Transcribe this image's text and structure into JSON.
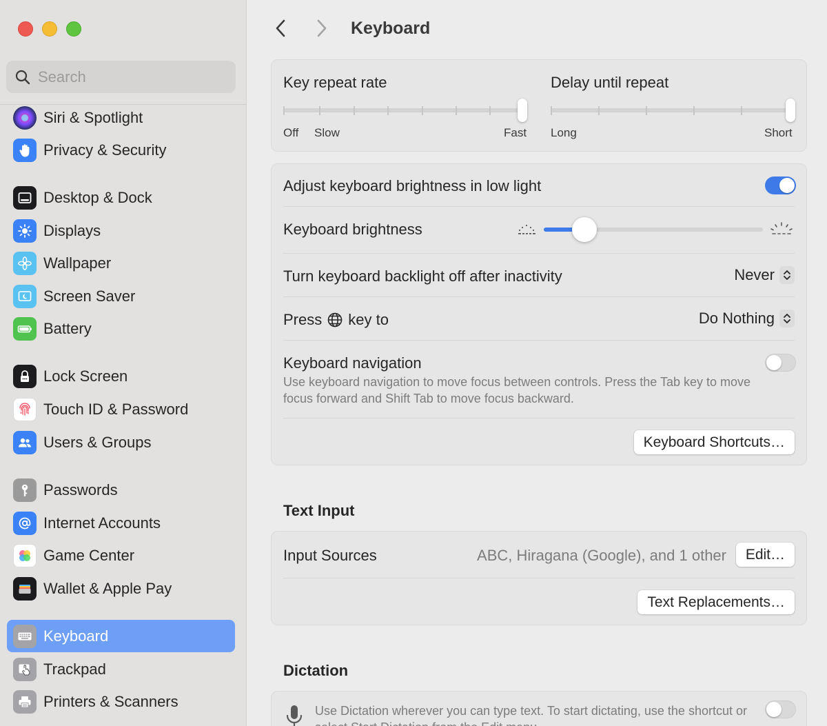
{
  "window": {
    "title": "Keyboard"
  },
  "colors": {
    "accent": "#3f7be8",
    "sidebar_selection": "#6d9ff6"
  },
  "search": {
    "placeholder": "Search"
  },
  "sidebar": {
    "items": [
      {
        "label": "Siri & Spotlight",
        "icon": "siri-icon"
      },
      {
        "label": "Privacy & Security",
        "icon": "hand-icon"
      },
      {
        "label": "Desktop & Dock",
        "icon": "dock-icon"
      },
      {
        "label": "Displays",
        "icon": "sun-icon"
      },
      {
        "label": "Wallpaper",
        "icon": "flower-icon"
      },
      {
        "label": "Screen Saver",
        "icon": "screensaver-icon"
      },
      {
        "label": "Battery",
        "icon": "battery-icon"
      },
      {
        "label": "Lock Screen",
        "icon": "lock-icon"
      },
      {
        "label": "Touch ID & Password",
        "icon": "fingerprint-icon"
      },
      {
        "label": "Users & Groups",
        "icon": "users-icon"
      },
      {
        "label": "Passwords",
        "icon": "key-icon"
      },
      {
        "label": "Internet Accounts",
        "icon": "at-icon"
      },
      {
        "label": "Game Center",
        "icon": "game-center-icon"
      },
      {
        "label": "Wallet & Apple Pay",
        "icon": "wallet-icon"
      },
      {
        "label": "Keyboard",
        "icon": "keyboard-icon",
        "selected": true
      },
      {
        "label": "Trackpad",
        "icon": "trackpad-icon"
      },
      {
        "label": "Printers & Scanners",
        "icon": "printer-icon"
      }
    ]
  },
  "repeat": {
    "key_repeat_rate": {
      "label": "Key repeat rate",
      "min_label_1": "Off",
      "min_label_2": "Slow",
      "max_label": "Fast",
      "value_fraction": 1.0
    },
    "delay_until_repeat": {
      "label": "Delay until repeat",
      "min_label": "Long",
      "max_label": "Short",
      "value_fraction": 1.0
    }
  },
  "lighting": {
    "adjust_brightness_label": "Adjust keyboard brightness in low light",
    "adjust_brightness_on": true,
    "brightness_label": "Keyboard brightness",
    "brightness_fraction": 0.13,
    "backlight_label": "Turn keyboard backlight off after inactivity",
    "backlight_value": "Never",
    "press_key_prefix": "Press",
    "press_key_suffix": "key to",
    "press_key_value": "Do Nothing",
    "navigation_label": "Keyboard navigation",
    "navigation_desc": "Use keyboard navigation to move focus between controls. Press the Tab key to move focus forward and Shift Tab to move focus backward.",
    "navigation_on": false,
    "shortcuts_button": "Keyboard Shortcuts…"
  },
  "text_input": {
    "section_title": "Text Input",
    "input_sources_label": "Input Sources",
    "input_sources_value": "ABC, Hiragana (Google), and 1 other",
    "edit_button": "Edit…",
    "replacements_button": "Text Replacements…"
  },
  "dictation": {
    "section_title": "Dictation",
    "desc": "Use Dictation wherever you can type text. To start dictating, use the shortcut or select Start Dictation from the Edit menu.",
    "enabled": false
  }
}
